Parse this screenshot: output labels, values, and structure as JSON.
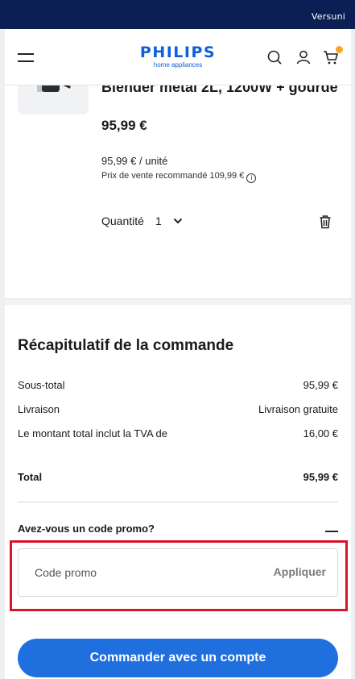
{
  "top_bar": {
    "brand": "Versuni"
  },
  "header": {
    "logo_word": "PHILIPS",
    "logo_sub": "home appliances"
  },
  "product": {
    "title": "Blender métal 2L, 1200W + gourde",
    "price": "95,99 €",
    "unit_price": "95,99 € / unité",
    "rrp": "Prix de vente recommandé 109,99 €",
    "quantity_label": "Quantité",
    "quantity_value": "1"
  },
  "summary": {
    "title": "Récapitulatif de la commande",
    "rows": [
      {
        "label": "Sous-total",
        "value": "95,99 €"
      },
      {
        "label": "Livraison",
        "value": "Livraison gratuite"
      },
      {
        "label": "Le montant total inclut la TVA de",
        "value": "16,00 €"
      },
      {
        "label": "Total",
        "value": "95,99 €"
      }
    ],
    "promo_question": "Avez-vous un code promo?",
    "promo_placeholder": "Code promo",
    "apply_label": "Appliquer",
    "checkout_label": "Commander avec un compte"
  },
  "colors": {
    "topbar": "#0b1f55",
    "brand_blue": "#0e5fd8",
    "cta": "#1f6fde",
    "highlight": "#d8142a",
    "badge": "#f5a623"
  },
  "icons": [
    "menu-icon",
    "search-icon",
    "account-icon",
    "cart-icon",
    "info-icon",
    "chevron-down-icon",
    "trash-icon",
    "minus-icon"
  ]
}
